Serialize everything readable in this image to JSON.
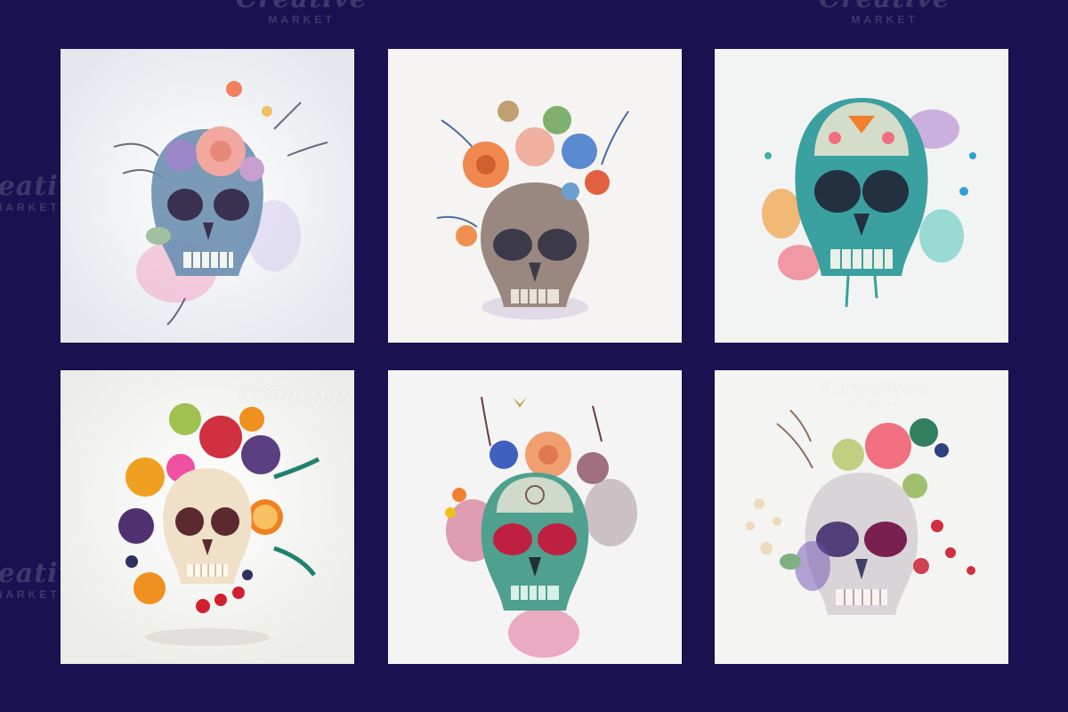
{
  "watermark": {
    "brand": "Creative",
    "sub": "MARKET"
  },
  "tiles": [
    {
      "id": 1,
      "accent": "#f0a0a8",
      "secondary": "#8a7fc0",
      "skull": "#6b8fb0"
    },
    {
      "id": 2,
      "accent": "#f08850",
      "secondary": "#5a8ad0",
      "skull": "#9a8880"
    },
    {
      "id": 3,
      "accent": "#f07080",
      "secondary": "#40c0b0",
      "skull": "#3aa0a0"
    },
    {
      "id": 4,
      "accent": "#f04060",
      "secondary": "#f0a020",
      "skull": "#f0e0c8"
    },
    {
      "id": 5,
      "accent": "#f0a070",
      "secondary": "#c03060",
      "skull": "#50a090"
    },
    {
      "id": 6,
      "accent": "#f07080",
      "secondary": "#7050b0",
      "skull": "#e0dcd8"
    }
  ],
  "colors": {
    "background": "#1a1150",
    "tile_bg": "#f4f4f2"
  }
}
